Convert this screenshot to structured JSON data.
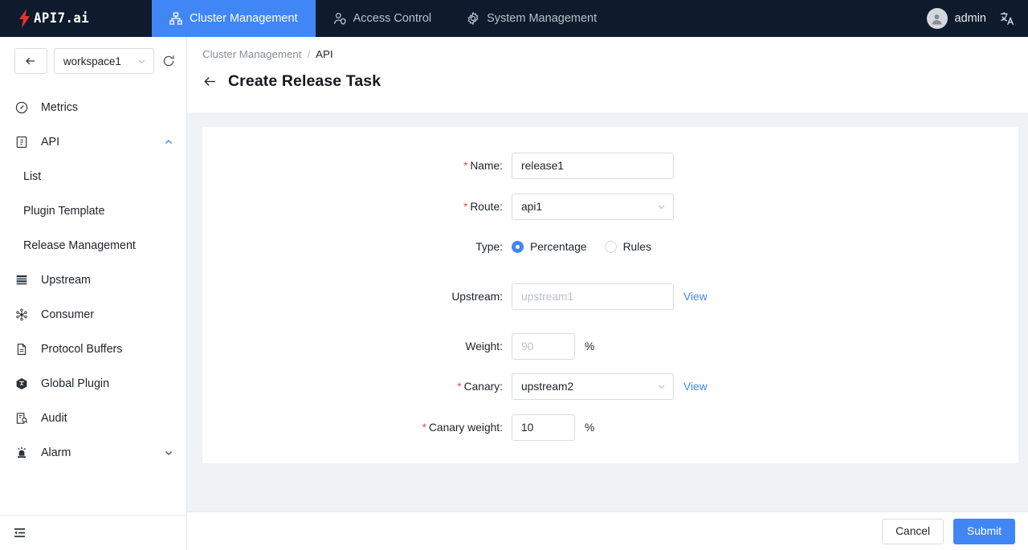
{
  "brand": {
    "logo_text": "API7.ai",
    "accent_red": "#e8322a",
    "accent_blue": "#4086f4",
    "header_bg": "#0d1b2c"
  },
  "topnav": {
    "tabs": [
      {
        "label": "Cluster Management",
        "icon": "sitemap-icon",
        "active": true
      },
      {
        "label": "Access Control",
        "icon": "user-shield-icon",
        "active": false
      },
      {
        "label": "System Management",
        "icon": "gear-icon",
        "active": false
      }
    ],
    "user": {
      "name": "admin",
      "avatar_icon": "user-avatar-icon"
    },
    "language_icon": "translate-icon"
  },
  "sidebar": {
    "back_icon": "arrow-left-icon",
    "workspace": {
      "value": "workspace1",
      "chevron_icon": "chevron-down-icon"
    },
    "refresh_icon": "refresh-icon",
    "items": [
      {
        "label": "Metrics",
        "icon": "gauge-icon",
        "expandable": false
      },
      {
        "label": "API",
        "icon": "api-doc-icon",
        "expandable": true,
        "expanded": true
      },
      {
        "label": "Upstream",
        "icon": "server-stack-icon",
        "expandable": false
      },
      {
        "label": "Consumer",
        "icon": "nodes-icon",
        "expandable": false
      },
      {
        "label": "Protocol Buffers",
        "icon": "file-icon",
        "expandable": false
      },
      {
        "label": "Global Plugin",
        "icon": "cube-icon",
        "expandable": false
      },
      {
        "label": "Audit",
        "icon": "audit-search-icon",
        "expandable": false
      },
      {
        "label": "Alarm",
        "icon": "alarm-lamp-icon",
        "expandable": true,
        "expanded": false
      }
    ],
    "api_subitems": [
      {
        "label": "List"
      },
      {
        "label": "Plugin Template"
      },
      {
        "label": "Release Management"
      }
    ],
    "collapse_icon": "menu-fold-icon"
  },
  "page": {
    "breadcrumb": {
      "parent": "Cluster Management",
      "separator": "/",
      "current": "API"
    },
    "back_icon": "arrow-left-icon",
    "title": "Create Release Task"
  },
  "form": {
    "name": {
      "label": "Name",
      "required": true,
      "value": "release1",
      "colon": ":"
    },
    "route": {
      "label": "Route",
      "required": true,
      "value": "api1",
      "chevron_icon": "chevron-down-icon",
      "colon": ":"
    },
    "type": {
      "label": "Type",
      "required": false,
      "colon": ":",
      "options": [
        {
          "label": "Percentage",
          "selected": true
        },
        {
          "label": "Rules",
          "selected": false
        }
      ]
    },
    "upstream": {
      "label": "Upstream",
      "required": false,
      "placeholder": "upstream1",
      "value": "",
      "view_link": "View",
      "colon": ":"
    },
    "weight": {
      "label": "Weight",
      "required": false,
      "placeholder": "90",
      "value": "",
      "suffix": "%",
      "colon": ":"
    },
    "canary": {
      "label": "Canary",
      "required": true,
      "value": "upstream2",
      "chevron_icon": "chevron-down-icon",
      "view_link": "View",
      "colon": ":"
    },
    "canary_weight": {
      "label": "Canary weight",
      "required": true,
      "value": "10",
      "suffix": "%",
      "colon": ":"
    }
  },
  "footer": {
    "cancel_label": "Cancel",
    "submit_label": "Submit"
  }
}
